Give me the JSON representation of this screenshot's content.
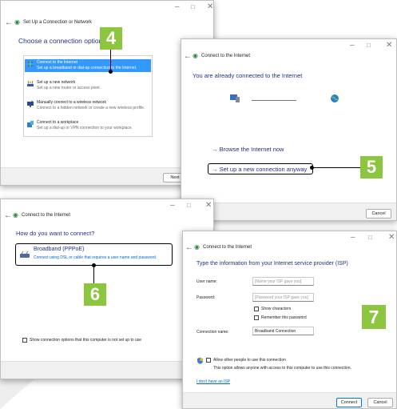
{
  "colors": {
    "accent": "#1e3287",
    "link": "#0066cc",
    "badge": "#8cc63f",
    "selection": "#3399ff"
  },
  "w1": {
    "title": "Set Up a Connection or Network",
    "heading": "Choose a connection option",
    "options": [
      {
        "t1": "Connect to the Internet",
        "t2": "Set up a broadband or dial-up connection to the Internet.",
        "icon": "globe-network-icon"
      },
      {
        "t1": "Set up a new network",
        "t2": "Set up a new router or access point.",
        "icon": "router-icon"
      },
      {
        "t1": "Manually connect to a wireless network",
        "t2": "Connect to a hidden network or create a new wireless profile.",
        "icon": "wireless-monitor-icon"
      },
      {
        "t1": "Connect to a workplace",
        "t2": "Set up a dial-up or VPN connection to your workplace.",
        "icon": "workplace-icon"
      }
    ],
    "next": "Next"
  },
  "w2": {
    "title": "Connect to the Internet",
    "heading": "You are already connected to the Internet",
    "browse": "→ Browse the Internet now",
    "setup": "→ Set up a new connection anyway",
    "cancel": "Cancel"
  },
  "w3": {
    "title": "Connect to the Internet",
    "heading": "How do you want to connect?",
    "opt_title": "Broadband (PPPoE)",
    "opt_desc": "Connect using DSL or cable that requires a user name and password.",
    "show_opts": "Show connection options that this computer is not set up to use"
  },
  "w4": {
    "title": "Connect to the Internet",
    "heading": "Type the information from your Internet service provider (ISP)",
    "username_label": "User name:",
    "username_placeholder": "[Name your ISP gave you]",
    "password_label": "Password:",
    "password_placeholder": "[Password your ISP gave you]",
    "show_chars": "Show characters",
    "remember": "Remember this password",
    "conn_label": "Connection name:",
    "conn_value": "Broadband Connection",
    "allow": "Allow other people to use this connection",
    "allow_desc": "This option allows anyone with access to this computer to use this connection.",
    "no_isp": "I don't have an ISP",
    "connect": "Connect",
    "cancel": "Cancel"
  },
  "badges": {
    "b4": "4",
    "b5": "5",
    "b6": "6",
    "b7": "7"
  },
  "win_controls": {
    "min": "–",
    "max": "□",
    "close": "✕"
  }
}
